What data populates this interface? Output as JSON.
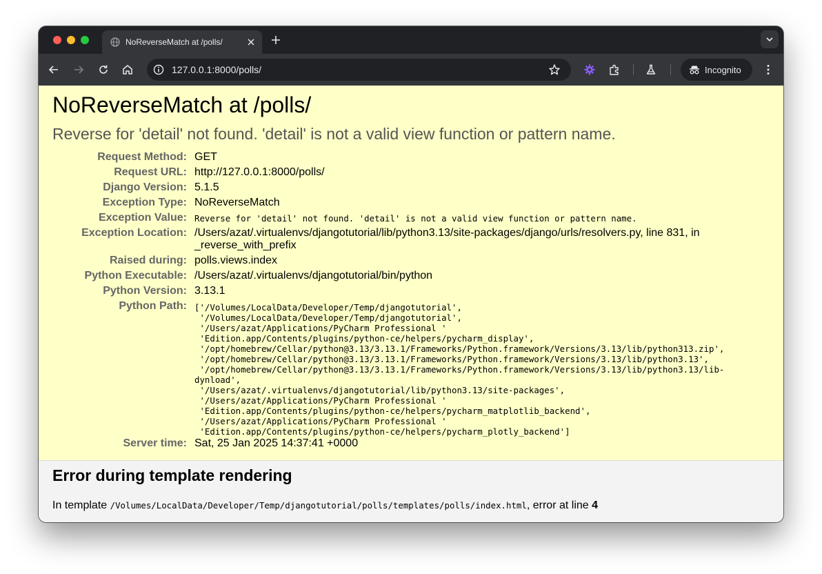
{
  "browser": {
    "tab_title": "NoReverseMatch at /polls/",
    "url": "127.0.0.1:8000/polls/",
    "incognito_label": "Incognito",
    "tab_icon": "globe-icon"
  },
  "page": {
    "title": "NoReverseMatch at /polls/",
    "subtitle": "Reverse for 'detail' not found. 'detail' is not a valid view function or pattern name.",
    "meta": {
      "request_method": {
        "label": "Request Method:",
        "value": "GET"
      },
      "request_url": {
        "label": "Request URL:",
        "value": "http://127.0.0.1:8000/polls/"
      },
      "django_version": {
        "label": "Django Version:",
        "value": "5.1.5"
      },
      "exception_type": {
        "label": "Exception Type:",
        "value": "NoReverseMatch"
      },
      "exception_value": {
        "label": "Exception Value:",
        "value": "Reverse for 'detail' not found. 'detail' is not a valid view function or pattern name."
      },
      "exception_location": {
        "label": "Exception Location:",
        "lines": [
          "/Users/azat/.virtualenvs/djangotutorial/lib/python3.13/site-packages/django/urls/resolvers.py, line 831, in",
          "_reverse_with_prefix"
        ]
      },
      "raised_during": {
        "label": "Raised during:",
        "value": "polls.views.index"
      },
      "python_executable": {
        "label": "Python Executable:",
        "value": "/Users/azat/.virtualenvs/djangotutorial/bin/python"
      },
      "python_version": {
        "label": "Python Version:",
        "value": "3.13.1"
      },
      "python_path": {
        "label": "Python Path:",
        "lines": [
          "['/Volumes/LocalData/Developer/Temp/djangotutorial',",
          " '/Volumes/LocalData/Developer/Temp/djangotutorial',",
          " '/Users/azat/Applications/PyCharm Professional '",
          " 'Edition.app/Contents/plugins/python-ce/helpers/pycharm_display',",
          " '/opt/homebrew/Cellar/python@3.13/3.13.1/Frameworks/Python.framework/Versions/3.13/lib/python313.zip',",
          " '/opt/homebrew/Cellar/python@3.13/3.13.1/Frameworks/Python.framework/Versions/3.13/lib/python3.13',",
          " '/opt/homebrew/Cellar/python@3.13/3.13.1/Frameworks/Python.framework/Versions/3.13/lib/python3.13/lib-",
          "dynload',",
          " '/Users/azat/.virtualenvs/djangotutorial/lib/python3.13/site-packages',",
          " '/Users/azat/Applications/PyCharm Professional '",
          " 'Edition.app/Contents/plugins/python-ce/helpers/pycharm_matplotlib_backend',",
          " '/Users/azat/Applications/PyCharm Professional '",
          " 'Edition.app/Contents/plugins/python-ce/helpers/pycharm_plotly_backend']"
        ]
      },
      "server_time": {
        "label": "Server time:",
        "value": "Sat, 25 Jan 2025 14:37:41 +0000"
      }
    },
    "template_error": {
      "title": "Error during template rendering",
      "prefix": "In template ",
      "path": "/Volumes/LocalData/Developer/Temp/djangotutorial/polls/templates/polls/index.html",
      "middle": ", error at line ",
      "line": "4"
    }
  },
  "colors": {
    "summary_bg": "#ffffc8",
    "template_bg": "#f3f3f3",
    "label_color": "#666666",
    "subtitle_color": "#555555"
  }
}
